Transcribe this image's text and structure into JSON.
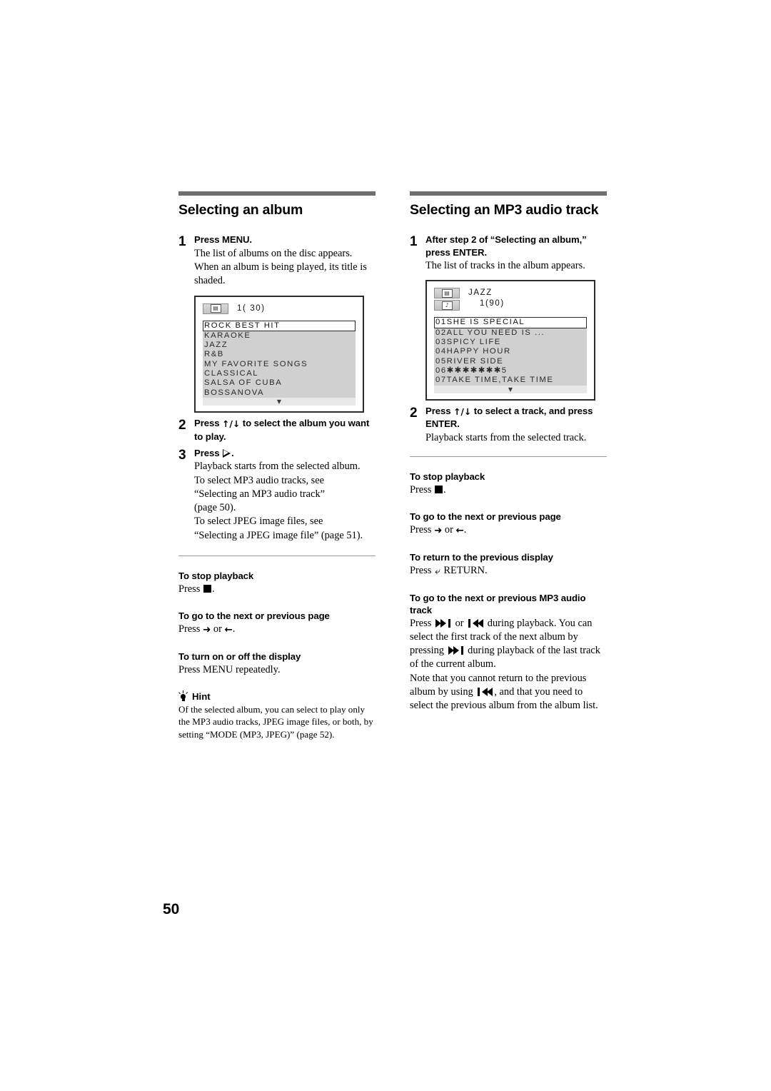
{
  "page": {
    "folio": "50"
  },
  "left_column": {
    "heading": "Selecting an album",
    "step1": {
      "num": "1",
      "head": "Press MENU.",
      "text": "The list of albums on the disc appears. When an album is being played, its title is shaded."
    },
    "lcd": {
      "icon_album": "album-folder-icon",
      "meta_line1": "1( 30)",
      "rows": [
        "ROCK BEST HIT",
        "KARAOKE",
        "JAZZ",
        "R&B",
        "MY FAVORITE SONGS",
        "CLASSICAL",
        "SALSA OF CUBA",
        "BOSSANOVA"
      ],
      "selected_index": 0,
      "scroll_glyph": "▼"
    },
    "step2": {
      "num": "2",
      "head_pre": "Press ",
      "head_sym": "↑/↓",
      "head_post": " to select the album you want to play."
    },
    "step3": {
      "num": "3",
      "head_pre": "Press ",
      "head_post": ".",
      "text_lines": [
        "Playback starts from the selected album.",
        "To select MP3 audio tracks, see",
        "“Selecting an MP3 audio track”",
        "(page 50).",
        "To select JPEG image files, see",
        "“Selecting a JPEG image file” (page 51)."
      ]
    },
    "sections": [
      {
        "head": "To stop playback",
        "body_pre": "Press ",
        "body_post": "."
      },
      {
        "head": "To go to the next or previous page",
        "body_pre": "Press ",
        "body_mid": " or ",
        "body_post": "."
      },
      {
        "head": "To turn on or off the display",
        "body": "Press MENU repeatedly."
      }
    ],
    "hint": {
      "label": "Hint",
      "icon": "lightbulb-icon",
      "text": "Of the selected album, you can select to play only the MP3 audio tracks, JPEG image files, or both, by setting “MODE (MP3, JPEG)” (page 52)."
    }
  },
  "right_column": {
    "heading": "Selecting an MP3 audio track",
    "step1": {
      "num": "1",
      "head": "After step 2 of “Selecting an album,” press ENTER.",
      "text": "The list of tracks in the album appears."
    },
    "lcd": {
      "icon_album": "album-folder-icon",
      "icon_track": "music-note-icon",
      "meta_line1": "JAZZ",
      "meta_line2": "1(90)",
      "rows": [
        "01SHE IS SPECIAL",
        "02ALL YOU NEED IS ...",
        "03SPICY LIFE",
        "04HAPPY HOUR",
        "05RIVER SIDE",
        "06✱✱✱✱✱✱✱5",
        "07TAKE TIME,TAKE TIME"
      ],
      "selected_index": 0,
      "scroll_glyph": "▼"
    },
    "step2": {
      "num": "2",
      "head_pre": "Press ",
      "head_sym": "↑/↓",
      "head_post": " to select a track, and press ENTER.",
      "text": "Playback starts from the selected track."
    },
    "sections": [
      {
        "head": "To stop playback",
        "body_pre": "Press ",
        "body_post": "."
      },
      {
        "head": "To go to the next or previous page",
        "body_pre": "Press ",
        "body_mid": " or ",
        "body_post": "."
      },
      {
        "head": "To return to the previous display",
        "body_pre": "Press ",
        "body_post": " RETURN."
      },
      {
        "head": "To go to the next or previous MP3 audio track",
        "body_p1a": "Press ",
        "body_p1b": " or ",
        "body_p1c": " during playback. You can select the first track of the next album by pressing ",
        "body_p1d": " during playback of the last track of the current album.",
        "body_p2a": "Note that you cannot return to the previous album by using ",
        "body_p2b": ", and that you need to select the previous album from the album list."
      }
    ]
  },
  "colors": {
    "rule": "#6e6e6e",
    "thin_rule": "#9a9a9a",
    "lcd_border": "#2b2b2b",
    "lcd_list_bg": "#d0d0d0"
  }
}
